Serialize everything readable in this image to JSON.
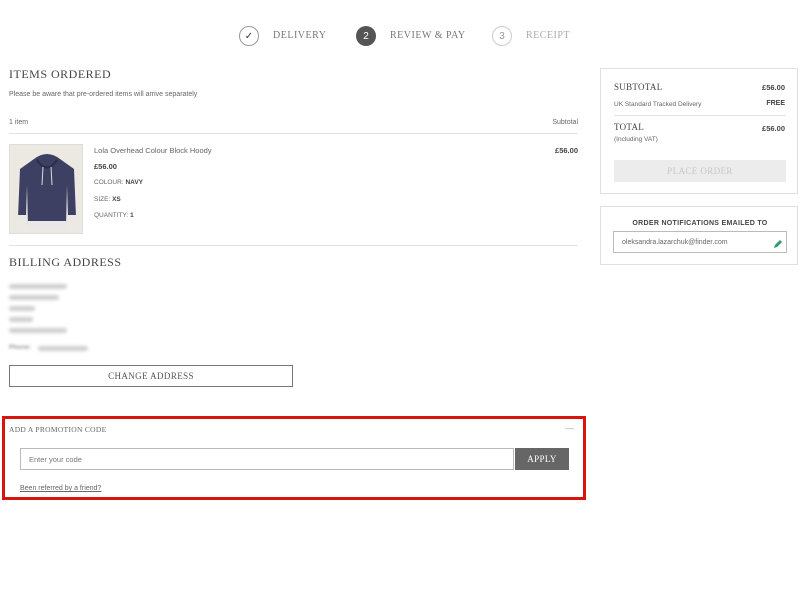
{
  "steps": [
    {
      "label": "DELIVERY",
      "symbol": "✓"
    },
    {
      "label": "REVIEW & PAY",
      "symbol": "2"
    },
    {
      "label": "RECEIPT",
      "symbol": "3"
    }
  ],
  "items": {
    "title": "ITEMS ORDERED",
    "notice": "Please be aware that pre-ordered items will arrive separately",
    "count_label": "1 item",
    "subtotal_header": "Subtotal",
    "product": {
      "name": "Lola Overhead Colour Block Hoody",
      "price": "£56.00",
      "line_total": "£56.00",
      "colour_label": "COLOUR:",
      "colour": "NAVY",
      "size_label": "SIZE:",
      "size": "XS",
      "quantity_label": "QUANTITY:",
      "quantity": "1"
    }
  },
  "billing": {
    "title": "BILLING ADDRESS",
    "phone_label": "Phone:",
    "change_button": "CHANGE ADDRESS"
  },
  "promo": {
    "title": "ADD A PROMOTION CODE",
    "collapse_symbol": "—",
    "placeholder": "Enter your code",
    "apply_button": "APPLY",
    "referral_link": "Been referred by a friend?"
  },
  "summary": {
    "subtotal_label": "SUBTOTAL",
    "subtotal_value": "£56.00",
    "delivery_label": "UK Standard Tracked Delivery",
    "delivery_value": "FREE",
    "total_label": "TOTAL",
    "total_value": "£56.00",
    "vat_note": "(Including VAT)",
    "place_order_button": "PLACE ORDER"
  },
  "notifications": {
    "title": "ORDER NOTIFICATIONS EMAILED TO",
    "email": "oleksandra.lazarchuk@finder.com"
  },
  "colors": {
    "highlight_border": "#d9140d",
    "apply_button_bg": "#666666",
    "edit_icon": "#2e9a6b"
  },
  "icons": {
    "checkmark": "check-icon",
    "edit": "pencil-icon"
  }
}
